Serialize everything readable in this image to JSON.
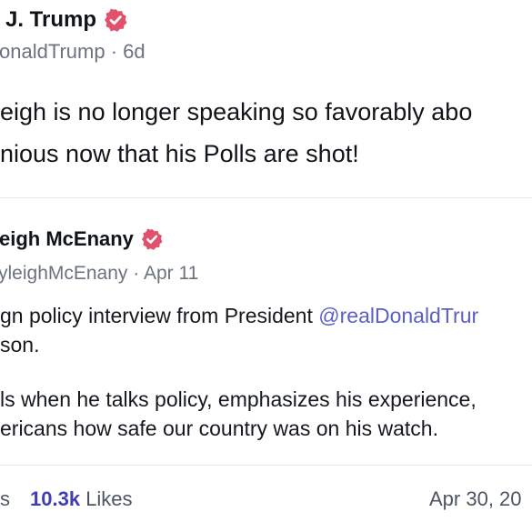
{
  "post": {
    "author_name": "J. Trump",
    "handle": "onaldTrump",
    "time_sep": "·",
    "time": "6d",
    "text_line1": "eigh is no longer speaking so favorably abo",
    "text_line2": "nious now that his Polls are shot!"
  },
  "quoted": {
    "author_name": "eigh McEnany",
    "handle": "yleighMcEnany",
    "time_sep": "·",
    "time": "Apr 11",
    "line1_prefix": "gn policy interview from President ",
    "line1_mention": "@realDonaldTrur",
    "line2": "son.",
    "line3": "ls when he talks policy, emphasizes his experience,",
    "line4": "ericans how safe our country was on his watch."
  },
  "footer": {
    "retweets_suffix": "s",
    "likes_count": "10.3k",
    "likes_label": "Likes",
    "date": "Apr 30, 20"
  },
  "colors": {
    "badge": "#e0526b",
    "mention": "#5b5fc7",
    "likes": "#3f3fb0"
  }
}
